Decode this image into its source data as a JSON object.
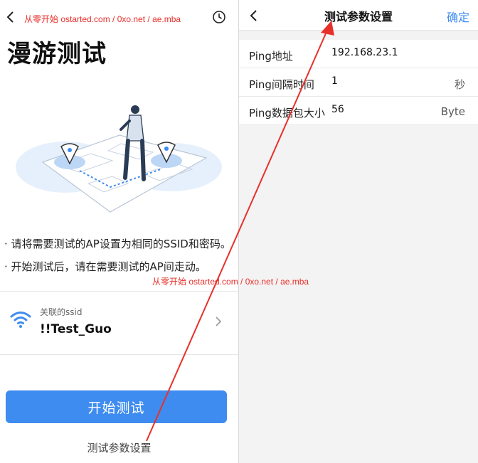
{
  "left_screen": {
    "title": "漫游测试",
    "bullets": [
      "· 请将需要测试的AP设置为相同的SSID和密码。",
      "· 开始测试后，请在需要测试的AP间走动。"
    ],
    "ssid_caption": "关联的ssid",
    "ssid_value": "!!Test_Guo",
    "start_button": "开始测试",
    "params_link": "测试参数设置"
  },
  "right_screen": {
    "title": "测试参数设置",
    "confirm": "确定",
    "rows": [
      {
        "label": "Ping地址",
        "value": "192.168.23.1",
        "unit": ""
      },
      {
        "label": "Ping间隔时间",
        "value": "1",
        "unit": "秒"
      },
      {
        "label": "Ping数据包大小",
        "value": "56",
        "unit": "Byte"
      }
    ]
  },
  "watermark": "从零开始 ostarted.com / 0xo.net / ae.mba",
  "colors": {
    "accent": "#3f8cf0",
    "annotation": "#e8302a"
  },
  "icons": [
    "back-arrow-icon",
    "clock-icon",
    "wifi-icon",
    "chevron-right-icon"
  ]
}
